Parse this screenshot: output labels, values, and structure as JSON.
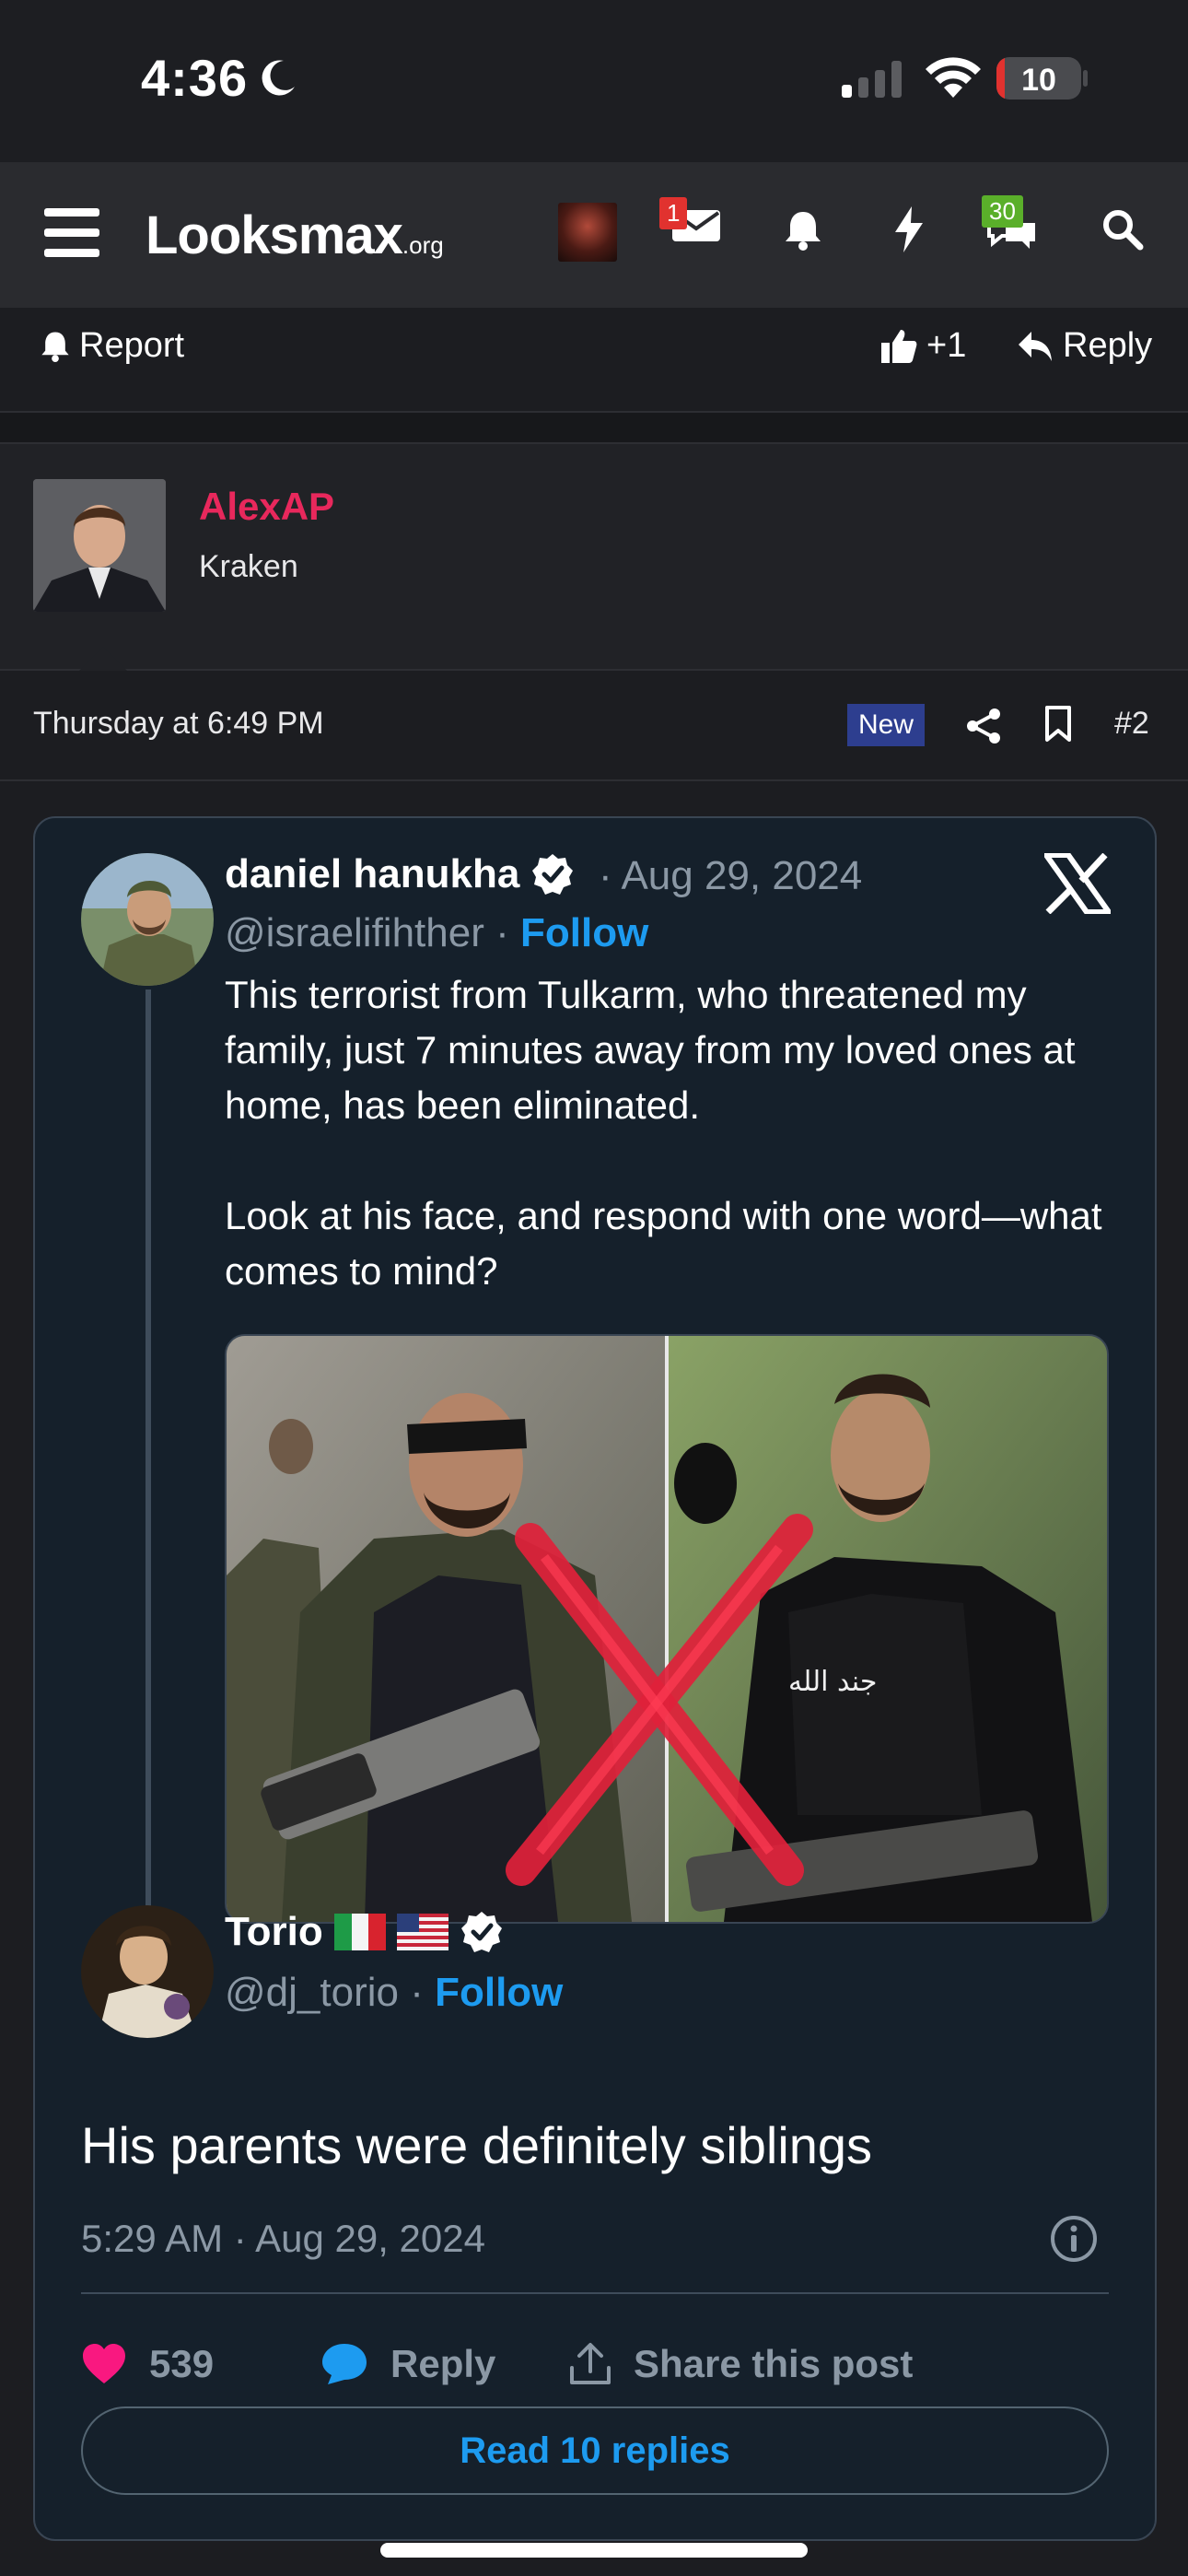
{
  "status_bar": {
    "time": "4:36",
    "battery": "10",
    "battery_level": 0.1
  },
  "header": {
    "logo_main": "Looksmax",
    "logo_suffix": ".org",
    "inbox_badge": "1",
    "alerts_badge": "30",
    "colors": {
      "header_bg": "#2a2b2f",
      "badge_red": "#e1322f",
      "badge_green": "#5aaf2a"
    }
  },
  "post_actions": {
    "report": "Report",
    "like_count": "+1",
    "reply": "Reply"
  },
  "user": {
    "name": "AlexAP",
    "title": "Kraken",
    "name_color": "#e8285c"
  },
  "post_meta": {
    "date": "Thursday at 6:49 PM",
    "new_label": "New",
    "post_number": "#2"
  },
  "tweet": {
    "author_name": "daniel hanukha",
    "date": "· Aug 29, 2024",
    "handle": "@israelifihther ·",
    "follow": "Follow",
    "text": "This terrorist from Tulkarm, who threatened my family, just 7 minutes away from my loved ones at home, has been eliminated.\n\nLook at his face, and respond with one word—what comes to mind?",
    "image_caption": "",
    "image_overlay_text": "جند الله"
  },
  "reply_tweet": {
    "author_name": "Torio",
    "handle": "@dj_torio ·",
    "follow": "Follow",
    "text": "His parents were definitely siblings",
    "timestamp": "5:29 AM · Aug 29, 2024",
    "likes": "539",
    "reply_label": "Reply",
    "share_label": "Share this post",
    "read_replies": "Read 10 replies",
    "colors": {
      "like": "#f91880",
      "link": "#1d9bf0",
      "card_bg": "#15202b"
    }
  }
}
